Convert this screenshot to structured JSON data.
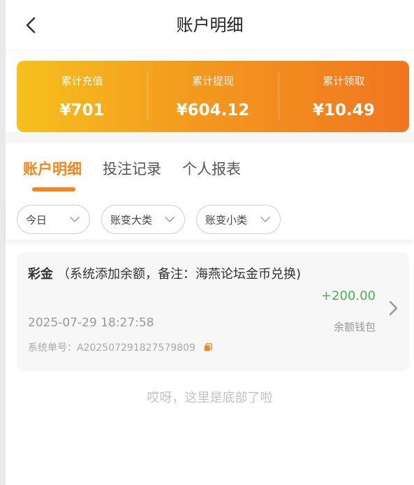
{
  "header": {
    "title": "账户明细",
    "back_icon": "chevron-left-icon"
  },
  "summary": {
    "items": [
      {
        "label": "累计充值",
        "value": "¥701"
      },
      {
        "label": "累计提现",
        "value": "¥604.12"
      },
      {
        "label": "累计领取",
        "value": "¥10.49"
      }
    ],
    "gradient_colors": [
      "#f6c01d",
      "#f27520"
    ]
  },
  "tabs": {
    "items": [
      {
        "label": "账户明细",
        "active": true
      },
      {
        "label": "投注记录",
        "active": false
      },
      {
        "label": "个人报表",
        "active": false
      }
    ],
    "accent_color": "#f3861e"
  },
  "filters": {
    "items": [
      {
        "label": "今日"
      },
      {
        "label": "账变大类"
      },
      {
        "label": "账变小类"
      }
    ],
    "dropdown_icon": "chevron-down-icon"
  },
  "records": [
    {
      "type": "彩金",
      "description": "（系统添加余额，备注：海燕论坛金币兑换)",
      "time": "2025-07-29 18:27:58",
      "order_no": "系统单号：A202507291827579809",
      "amount": "+200.00",
      "wallet": "余额钱包",
      "amount_color": "#4caf50"
    }
  ],
  "bottom_note": "哎呀，这里是底部了啦"
}
